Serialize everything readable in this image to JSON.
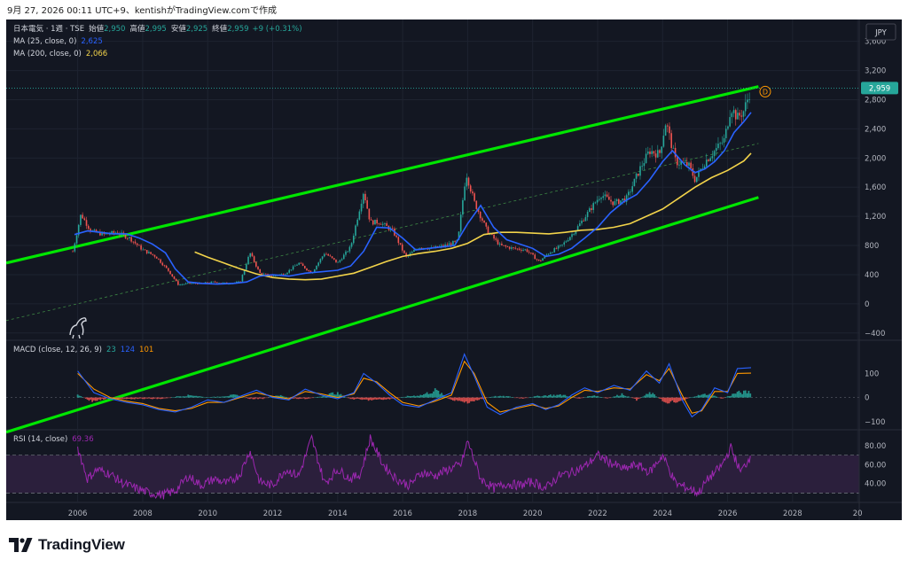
{
  "caption": "9月 27, 2026 00:11 UTC+9、kentishがTradingView.comで作成",
  "brand": {
    "name": "TradingView"
  },
  "colors": {
    "background": "#131722",
    "grid": "#1e2330",
    "channel": "#00e600",
    "ma25": "#2962ff",
    "ma200": "#f2d34a",
    "up": "#26a69a",
    "down": "#ef5350",
    "rsi": "#9c27b0",
    "rsi_band": "#2b1f3c",
    "macd_signal": "#ff9800",
    "text": "#d1d4dc",
    "axis_text": "#b2b5be"
  },
  "header": {
    "symbol": "日本電気 · 1週 · TSE",
    "open_label": "始値",
    "open": "2,950",
    "high_label": "高値",
    "high": "2,995",
    "low_label": "安値",
    "low": "2,925",
    "close_label": "終値",
    "close": "2,959",
    "change": "+9 (+0.31%)",
    "ma25_label": "MA (25, close, 0)",
    "ma25_value": "2,625",
    "ma200_label": "MA (200, close, 0)",
    "ma200_value": "2,066",
    "currency": "JPY",
    "last_price_tag": "2,959",
    "event_marker": "D"
  },
  "macd_header": {
    "label": "MACD (close, 12, 26, 9)",
    "hist": "23",
    "macd": "124",
    "signal": "101"
  },
  "rsi_header": {
    "label": "RSI (14, close)",
    "value": "69.36"
  },
  "chart_data": [
    {
      "type": "line",
      "name": "price",
      "title": "日本電気 · 1週 · TSE",
      "ylim": [
        -500,
        3900
      ],
      "yticks": [
        "3,600",
        "3,200",
        "2,800",
        "2,400",
        "2,000",
        "1,600",
        "1,200",
        "800",
        "400",
        "0",
        "−400"
      ],
      "x": [
        2005.85,
        2006.1,
        2006.4,
        2006.8,
        2007.2,
        2007.6,
        2008.0,
        2008.4,
        2008.8,
        2009.1,
        2009.4,
        2009.8,
        2010.2,
        2010.6,
        2011.0,
        2011.3,
        2011.6,
        2012.0,
        2012.4,
        2012.8,
        2013.2,
        2013.6,
        2014.0,
        2014.4,
        2014.8,
        2015.0,
        2015.3,
        2015.7,
        2016.1,
        2016.5,
        2016.9,
        2017.3,
        2017.7,
        2017.95,
        2018.2,
        2018.6,
        2019.0,
        2019.4,
        2019.8,
        2020.2,
        2020.5,
        2020.9,
        2021.3,
        2021.7,
        2022.1,
        2022.5,
        2022.9,
        2023.3,
        2023.6,
        2023.9,
        2024.1,
        2024.4,
        2024.8,
        2025.0,
        2025.3,
        2025.6,
        2025.9,
        2026.1,
        2026.3,
        2026.5,
        2026.72
      ],
      "y": [
        720,
        1230,
        1000,
        950,
        980,
        900,
        740,
        650,
        450,
        260,
        280,
        280,
        300,
        280,
        300,
        700,
        420,
        380,
        420,
        560,
        420,
        700,
        560,
        780,
        1550,
        1120,
        1120,
        1000,
        640,
        780,
        760,
        800,
        860,
        1800,
        1400,
        1000,
        800,
        760,
        740,
        580,
        700,
        800,
        1000,
        1250,
        1500,
        1380,
        1450,
        1850,
        2100,
        2050,
        2500,
        1950,
        1900,
        1700,
        1950,
        2100,
        2250,
        2700,
        2550,
        2650,
        2959
      ],
      "series": [
        {
          "name": "MA (25, close, 0)",
          "x": [
            2005.9,
            2006.3,
            2006.7,
            2007.1,
            2007.5,
            2007.9,
            2008.3,
            2008.7,
            2009.0,
            2009.4,
            2009.8,
            2010.3,
            2010.8,
            2011.2,
            2011.6,
            2012.0,
            2012.5,
            2013.0,
            2013.5,
            2014.0,
            2014.4,
            2014.8,
            2015.2,
            2015.6,
            2016.0,
            2016.4,
            2016.8,
            2017.2,
            2017.6,
            2018.0,
            2018.4,
            2018.8,
            2019.2,
            2019.6,
            2020.0,
            2020.4,
            2020.8,
            2021.2,
            2021.6,
            2022.0,
            2022.4,
            2022.8,
            2023.2,
            2023.6,
            2024.0,
            2024.3,
            2024.7,
            2025.0,
            2025.3,
            2025.6,
            2025.9,
            2026.2,
            2026.5,
            2026.72
          ],
          "y": [
            950,
            1000,
            980,
            960,
            960,
            900,
            820,
            700,
            480,
            300,
            280,
            270,
            280,
            300,
            380,
            400,
            380,
            420,
            440,
            460,
            520,
            720,
            1050,
            1040,
            900,
            740,
            760,
            780,
            800,
            1100,
            1350,
            1050,
            880,
            820,
            760,
            650,
            680,
            760,
            900,
            1050,
            1250,
            1400,
            1500,
            1700,
            1950,
            2100,
            1900,
            1800,
            1850,
            1950,
            2100,
            2350,
            2500,
            2625
          ]
        },
        {
          "name": "MA (200, close, 0)",
          "x": [
            2009.6,
            2010.0,
            2010.5,
            2011.0,
            2011.5,
            2012.0,
            2012.5,
            2013.0,
            2013.5,
            2014.0,
            2014.5,
            2015.0,
            2015.5,
            2016.0,
            2016.5,
            2017.0,
            2017.5,
            2018.0,
            2018.5,
            2019.0,
            2019.5,
            2020.0,
            2020.5,
            2021.0,
            2021.5,
            2022.0,
            2022.5,
            2023.0,
            2023.5,
            2024.0,
            2024.5,
            2025.0,
            2025.5,
            2026.0,
            2026.5,
            2026.72
          ],
          "y": [
            710,
            640,
            560,
            480,
            410,
            360,
            340,
            330,
            340,
            380,
            420,
            500,
            580,
            650,
            690,
            720,
            760,
            830,
            950,
            980,
            980,
            970,
            960,
            980,
            1010,
            1020,
            1050,
            1100,
            1200,
            1300,
            1450,
            1600,
            1730,
            1830,
            1960,
            2066
          ]
        }
      ],
      "channel_upper": {
        "x": [
          2003.8,
          2026.95
        ],
        "y": [
          560,
          2980
        ]
      },
      "channel_lower": {
        "x": [
          2003.8,
          2026.95
        ],
        "y": [
          -1760,
          1460
        ]
      },
      "channel_mid": {
        "x": [
          2003.8,
          2026.95
        ],
        "y": [
          -230,
          2200
        ]
      }
    },
    {
      "type": "line",
      "name": "MACD (close, 12, 26, 9)",
      "title": "MACD (close, 12, 26, 9)",
      "ylim": [
        -130,
        230
      ],
      "yticks": [
        "100",
        "0",
        "−100"
      ],
      "x": [
        2006.0,
        2006.5,
        2007.0,
        2007.5,
        2008.0,
        2008.5,
        2009.0,
        2009.5,
        2010.0,
        2010.5,
        2011.0,
        2011.5,
        2012.0,
        2012.5,
        2013.0,
        2013.5,
        2014.0,
        2014.5,
        2014.8,
        2015.2,
        2015.6,
        2016.0,
        2016.5,
        2017.0,
        2017.5,
        2017.9,
        2018.2,
        2018.6,
        2019.0,
        2019.5,
        2020.0,
        2020.4,
        2020.8,
        2021.2,
        2021.6,
        2022.0,
        2022.5,
        2023.0,
        2023.5,
        2023.9,
        2024.2,
        2024.6,
        2024.9,
        2025.2,
        2025.6,
        2026.0,
        2026.3,
        2026.72
      ],
      "series": [
        {
          "name": "MACD",
          "values": [
            110,
            20,
            -5,
            -20,
            -30,
            -50,
            -60,
            -40,
            -10,
            -20,
            5,
            30,
            0,
            -10,
            35,
            10,
            -5,
            20,
            100,
            60,
            10,
            -30,
            -40,
            -10,
            20,
            180,
            90,
            -40,
            -70,
            -40,
            -25,
            -50,
            -30,
            10,
            40,
            20,
            50,
            30,
            110,
            60,
            140,
            -10,
            -80,
            -50,
            40,
            20,
            120,
            124
          ]
        },
        {
          "name": "Signal",
          "values": [
            100,
            35,
            0,
            -15,
            -25,
            -45,
            -55,
            -45,
            -20,
            -20,
            0,
            20,
            5,
            -5,
            25,
            15,
            0,
            15,
            80,
            65,
            20,
            -20,
            -35,
            -15,
            10,
            150,
            100,
            -20,
            -60,
            -45,
            -30,
            -45,
            -35,
            0,
            30,
            25,
            40,
            35,
            95,
            70,
            120,
            10,
            -65,
            -55,
            25,
            25,
            100,
            101
          ]
        }
      ],
      "histogram": [
        10,
        -15,
        -5,
        -5,
        -5,
        -5,
        -5,
        5,
        10,
        0,
        5,
        10,
        -5,
        -5,
        10,
        -5,
        -5,
        5,
        20,
        -5,
        -10,
        -10,
        -5,
        5,
        10,
        30,
        -10,
        -20,
        -10,
        5,
        5,
        -5,
        5,
        10,
        10,
        -5,
        10,
        -5,
        15,
        -10,
        20,
        -20,
        -15,
        5,
        15,
        -5,
        20,
        23
      ]
    },
    {
      "type": "line",
      "name": "RSI (14, close)",
      "title": "RSI (14, close)",
      "ylim": [
        20,
        96
      ],
      "yticks": [
        "80.00",
        "60.00",
        "40.00"
      ],
      "band": [
        30,
        70
      ],
      "x": [
        2006.0,
        2006.3,
        2006.6,
        2007.0,
        2007.4,
        2007.8,
        2008.2,
        2008.6,
        2009.0,
        2009.4,
        2009.8,
        2010.2,
        2010.6,
        2011.0,
        2011.3,
        2011.6,
        2012.0,
        2012.4,
        2012.8,
        2013.2,
        2013.6,
        2014.0,
        2014.4,
        2014.7,
        2015.0,
        2015.4,
        2015.8,
        2016.2,
        2016.6,
        2017.0,
        2017.4,
        2017.8,
        2018.0,
        2018.4,
        2018.8,
        2019.2,
        2019.6,
        2020.0,
        2020.4,
        2020.8,
        2021.2,
        2021.6,
        2022.0,
        2022.4,
        2022.8,
        2023.2,
        2023.6,
        2024.0,
        2024.4,
        2024.8,
        2025.1,
        2025.4,
        2025.8,
        2026.1,
        2026.4,
        2026.72
      ],
      "values": [
        78,
        45,
        55,
        50,
        40,
        35,
        30,
        28,
        32,
        48,
        38,
        45,
        40,
        50,
        75,
        42,
        38,
        55,
        48,
        88,
        40,
        55,
        45,
        50,
        88,
        60,
        45,
        38,
        52,
        48,
        55,
        60,
        85,
        45,
        35,
        40,
        38,
        42,
        35,
        48,
        52,
        58,
        70,
        62,
        55,
        60,
        52,
        70,
        40,
        35,
        30,
        45,
        58,
        78,
        52,
        69.36
      ]
    }
  ],
  "x_axis": {
    "labels": [
      "2006",
      "2008",
      "2010",
      "2012",
      "2014",
      "2016",
      "2018",
      "2020",
      "2022",
      "2024",
      "2026",
      "2028",
      "20"
    ],
    "xlim": [
      2003.8,
      2030.05
    ]
  }
}
